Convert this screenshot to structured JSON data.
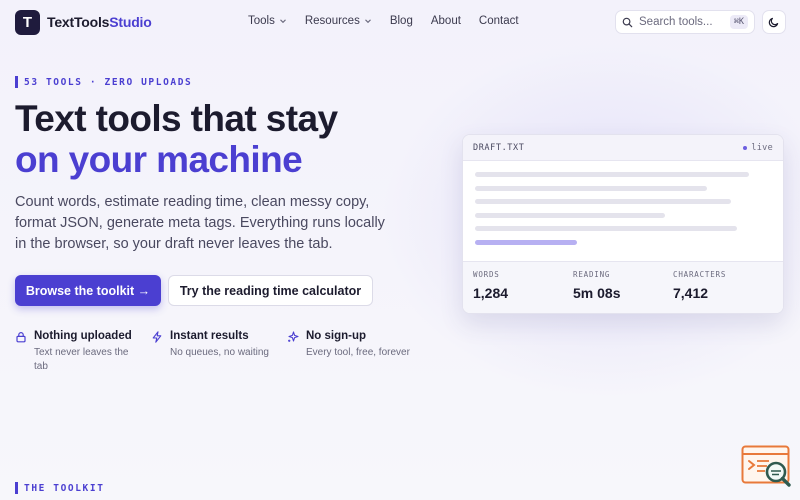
{
  "header": {
    "logo_letter": "T",
    "brand_part1": "TextTools",
    "brand_part2": "Studio",
    "nav": [
      {
        "label": "Tools",
        "has_caret": true
      },
      {
        "label": "Resources",
        "has_caret": true
      },
      {
        "label": "Blog",
        "has_caret": false
      },
      {
        "label": "About",
        "has_caret": false
      },
      {
        "label": "Contact",
        "has_caret": false
      }
    ],
    "search": {
      "placeholder": "Search tools...",
      "shortcut": "⌘K",
      "icon": "search-icon"
    },
    "theme_toggle_icon": "moon-icon"
  },
  "hero": {
    "eyebrow": "53 TOOLS · ZERO UPLOADS",
    "title_line1": "Text tools that stay",
    "title_line2": "on your machine",
    "description": "Count words, estimate reading time, clean messy copy, format JSON, generate meta tags. Everything runs locally in the browser, so your draft never leaves the tab.",
    "primary_button": "Browse the toolkit →",
    "secondary_button": "Try the reading time calculator",
    "features": [
      {
        "icon": "lock-icon",
        "title": "Nothing uploaded",
        "desc": "Text never leaves the tab"
      },
      {
        "icon": "bolt-icon",
        "title": "Instant results",
        "desc": "No queues, no waiting"
      },
      {
        "icon": "sparkle-icon",
        "title": "No sign-up",
        "desc": "Every tool, free, forever"
      }
    ]
  },
  "preview": {
    "filename": "DRAFT.TXT",
    "status": "live",
    "stats": [
      {
        "label": "WORDS",
        "value": "1,284"
      },
      {
        "label": "READING",
        "value": "5m 08s"
      },
      {
        "label": "CHARACTERS",
        "value": "7,412"
      }
    ]
  },
  "section": {
    "eyebrow": "THE TOOLKIT"
  },
  "colors": {
    "accent": "#4b3fd1",
    "dark": "#1f1b3d",
    "highlight": "#b7b0f2"
  }
}
